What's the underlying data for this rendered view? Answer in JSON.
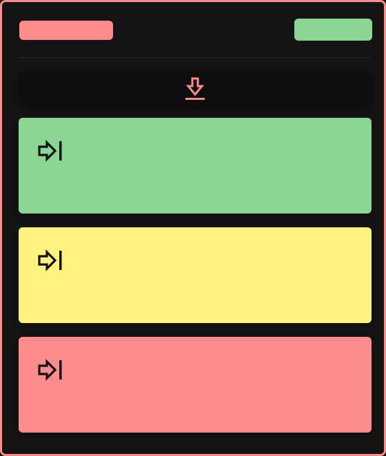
{
  "colors": {
    "frame_border": "#ff8c8c",
    "background": "#141414",
    "accent_red": "#ff8c8c",
    "accent_green": "#8cd694",
    "download_bar": "#0e0e0e"
  },
  "header": {
    "left_pill_color": "#ff8c8c",
    "right_pill_color": "#8cd694"
  },
  "download": {
    "icon": "download-icon",
    "icon_color": "#ff8c8c"
  },
  "cards": [
    {
      "color": "#8cd694",
      "icon": "arrow-right-to-bar-icon"
    },
    {
      "color": "#fff27f",
      "icon": "arrow-right-to-bar-icon"
    },
    {
      "color": "#ff8c8c",
      "icon": "arrow-right-to-bar-icon"
    }
  ]
}
